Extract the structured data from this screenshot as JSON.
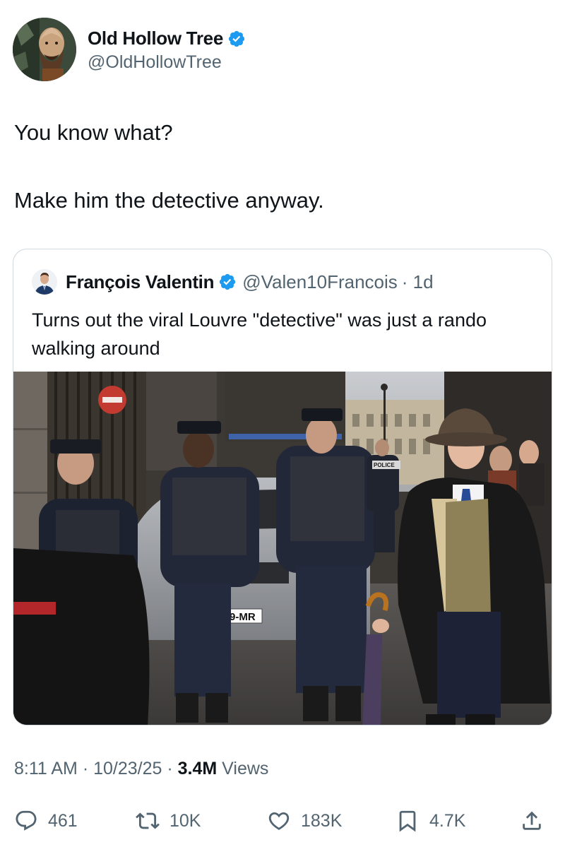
{
  "author": {
    "display_name": "Old Hollow Tree",
    "handle": "@OldHollowTree",
    "verified": true,
    "avatar_icon": "bearded-man-illustration-avatar"
  },
  "tweet": {
    "lines": [
      "You know what?",
      "Make him the detective anyway."
    ]
  },
  "quoted_tweet": {
    "display_name": "François Valentin",
    "handle": "@Valen10Francois",
    "time": "· 1d",
    "verified": true,
    "avatar_icon": "man-in-suit-avatar",
    "text": "Turns out the viral Louvre \"detective\" was just a rando walking around",
    "image": {
      "description_icon": "police-officers-and-young-man-in-fedora-photo",
      "plate_text": "9-MR",
      "sign_text": "POLICE"
    }
  },
  "meta": {
    "time": "8:11 AM",
    "sep1": " · ",
    "date": "10/23/25",
    "sep2": " · ",
    "views_count": "3.4M",
    "views_label": " Views"
  },
  "actions": {
    "replies": "461",
    "retweets": "10K",
    "likes": "183K",
    "bookmarks": "4.7K"
  },
  "colors": {
    "text": "#0f1419",
    "secondary": "#536471",
    "verified": "#1d9bf0",
    "border": "#cfd9de"
  }
}
